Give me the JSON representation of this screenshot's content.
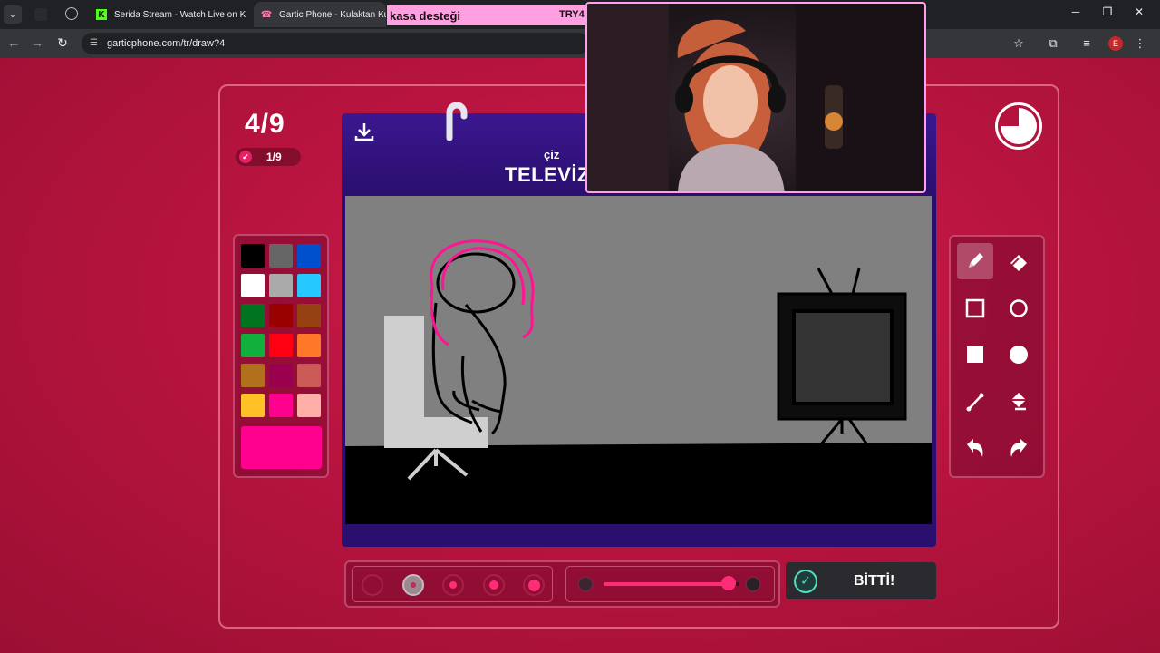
{
  "browser": {
    "tabs": [
      {
        "title": "Serida Stream - Watch Live on K",
        "icon": "kick-icon",
        "active": false
      },
      {
        "title": "Gartic Phone - Kulaktan Kulağ",
        "icon": "gartic-icon",
        "active": true
      }
    ],
    "url": "garticphone.com/tr/draw?4"
  },
  "overlay": {
    "ticker_text": "kasa desteği",
    "ticker_code": "TRY4"
  },
  "game": {
    "round": "4/9",
    "done_count": "1/9",
    "prompt_label": "çiz",
    "prompt_word": "TELEVİZ",
    "done_button": "BİTTİ!"
  },
  "palette": {
    "colors": [
      "#000000",
      "#666666",
      "#0050cd",
      "#ffffff",
      "#aaaaaa",
      "#26c9ff",
      "#017420",
      "#990000",
      "#964112",
      "#11b03c",
      "#ff0013",
      "#ff7829",
      "#b0701c",
      "#99004e",
      "#cb5a57",
      "#ffc126",
      "#ff008f",
      "#feafa8"
    ],
    "current": "#ff008f"
  },
  "tools": [
    "pencil-icon",
    "eraser-icon",
    "rectangle-outline-icon",
    "ellipse-outline-icon",
    "rectangle-filled-icon",
    "ellipse-filled-icon",
    "line-icon",
    "bucket-icon",
    "undo-icon",
    "redo-icon"
  ],
  "brush": {
    "selected_size_index": 1,
    "opacity_fraction": 0.92
  },
  "colors": {
    "accent": "#ff2d78",
    "panel": "#2b0f6e",
    "background": "#b8143f"
  }
}
